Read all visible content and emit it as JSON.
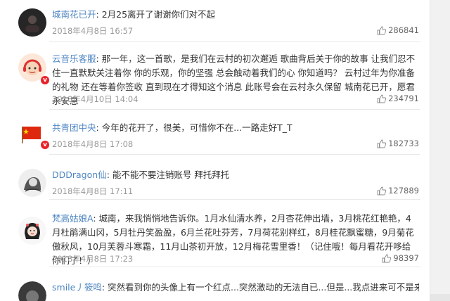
{
  "comments": [
    {
      "user": "城南花已开",
      "text": ": 2月25离开了谢谢你们对不起",
      "time": "2018年4月8日 16:57",
      "likes": "286841",
      "avatar_icon": "dark-circle-avatar"
    },
    {
      "user": "云音乐客服",
      "text": ": 那一年，这一首歌，是我们在云村的初次邂逅 歌曲背后关于你的故事 让我们忍不住一直默默关注着你 你的乐观，你的坚强 总会触动着我们的心 你知道吗？ 云村过年为你准备的礼物 还在等着你签收 直到现在才得知这个消息 此账号会在云村永久保留 城南花已开，愿君永安息",
      "time": "2018年4月10日 14:04",
      "likes": "234791",
      "avatar_icon": "red-headset-avatar"
    },
    {
      "user": "共青团中央",
      "text": ": 今年的花开了，很美，可惜你不在...一路走好T_T",
      "time": "2018年4月8日 17:08",
      "likes": "182733",
      "avatar_icon": "red-flag-avatar"
    },
    {
      "user": "DDDragon仙",
      "text": ": 能不能不要注销账号 拜托拜托",
      "time": "2018年4月8日 17:11",
      "likes": "127889",
      "avatar_icon": "sketch-portrait-avatar"
    },
    {
      "user": "梵高姑娘A",
      "text": ": 城南，来我悄悄地告诉你。1月水仙清水养，2月杏花伸出墙，3月桃花红艳艳，4月杜鹃满山冈，5月牡丹笑盈盈，6月兰花吐芬芳，7月荷花别样红，8月桂花飘蜜糖，9月菊花傲秋风，10月芙蓉斗寒霜，11月山茶初开放，12月梅花雪里香！（记住哦！每月看花开哆给你们了！）",
      "time": "2018年4月8日 17:23",
      "likes": "98397",
      "avatar_icon": "girl-portrait-avatar"
    },
    {
      "user": "smile丿筱鸣",
      "text": ": 突然看到你的头像上有一个红点...突然激动的无法自已...但是...我点进来可不是来看这个消息的......只能祈祷",
      "time": "",
      "likes": "",
      "avatar_icon": "cat-avatar"
    }
  ],
  "colors": {
    "username": "#4f86c2",
    "meta": "#999999",
    "badge": "#e8222a"
  }
}
